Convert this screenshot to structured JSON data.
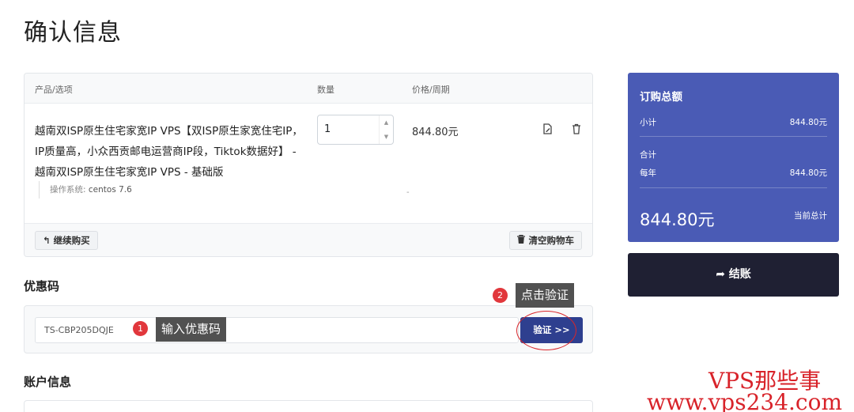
{
  "page": {
    "title": "确认信息"
  },
  "cart": {
    "headers": {
      "product": "产品/选项",
      "qty": "数量",
      "price": "价格/周期"
    },
    "item": {
      "name": "越南双ISP原生住宅家宽IP VPS【双ISP原生家宽住宅IP，IP质量高，小众西贡邮电运营商IP段，Tiktok数据好】 - 越南双ISP原生住宅家宽IP VPS - 基础版",
      "qty": "1",
      "price": "844.80元",
      "option_label": "操作系统:",
      "option_value": "centos 7.6",
      "option_price": "-"
    },
    "continue_label": "继续购买",
    "empty_label": "清空购物车"
  },
  "summary": {
    "title": "订购总额",
    "subtotal_label": "小计",
    "subtotal_value": "844.80元",
    "total_label": "合计",
    "yearly_label": "每年",
    "yearly_value": "844.80元",
    "grand_total": "844.80元",
    "grand_total_label": "当前总计"
  },
  "checkout": {
    "label": "结账"
  },
  "promo": {
    "title": "优惠码",
    "code": "TS-CBP205DQJE",
    "verify_label": "验证 >>"
  },
  "annotations": {
    "step1_num": "1",
    "step1_text": "输入优惠码",
    "step2_num": "2",
    "step2_text": "点击验证"
  },
  "account": {
    "title": "账户信息"
  },
  "watermark": "www.vps234.com",
  "watermark_top": "VPS那些事",
  "colors": {
    "summary_bg": "#4a5bb5",
    "checkout_bg": "#1f2033",
    "verify_bg": "#2e3f8f",
    "annotation_red": "#e1373c"
  }
}
